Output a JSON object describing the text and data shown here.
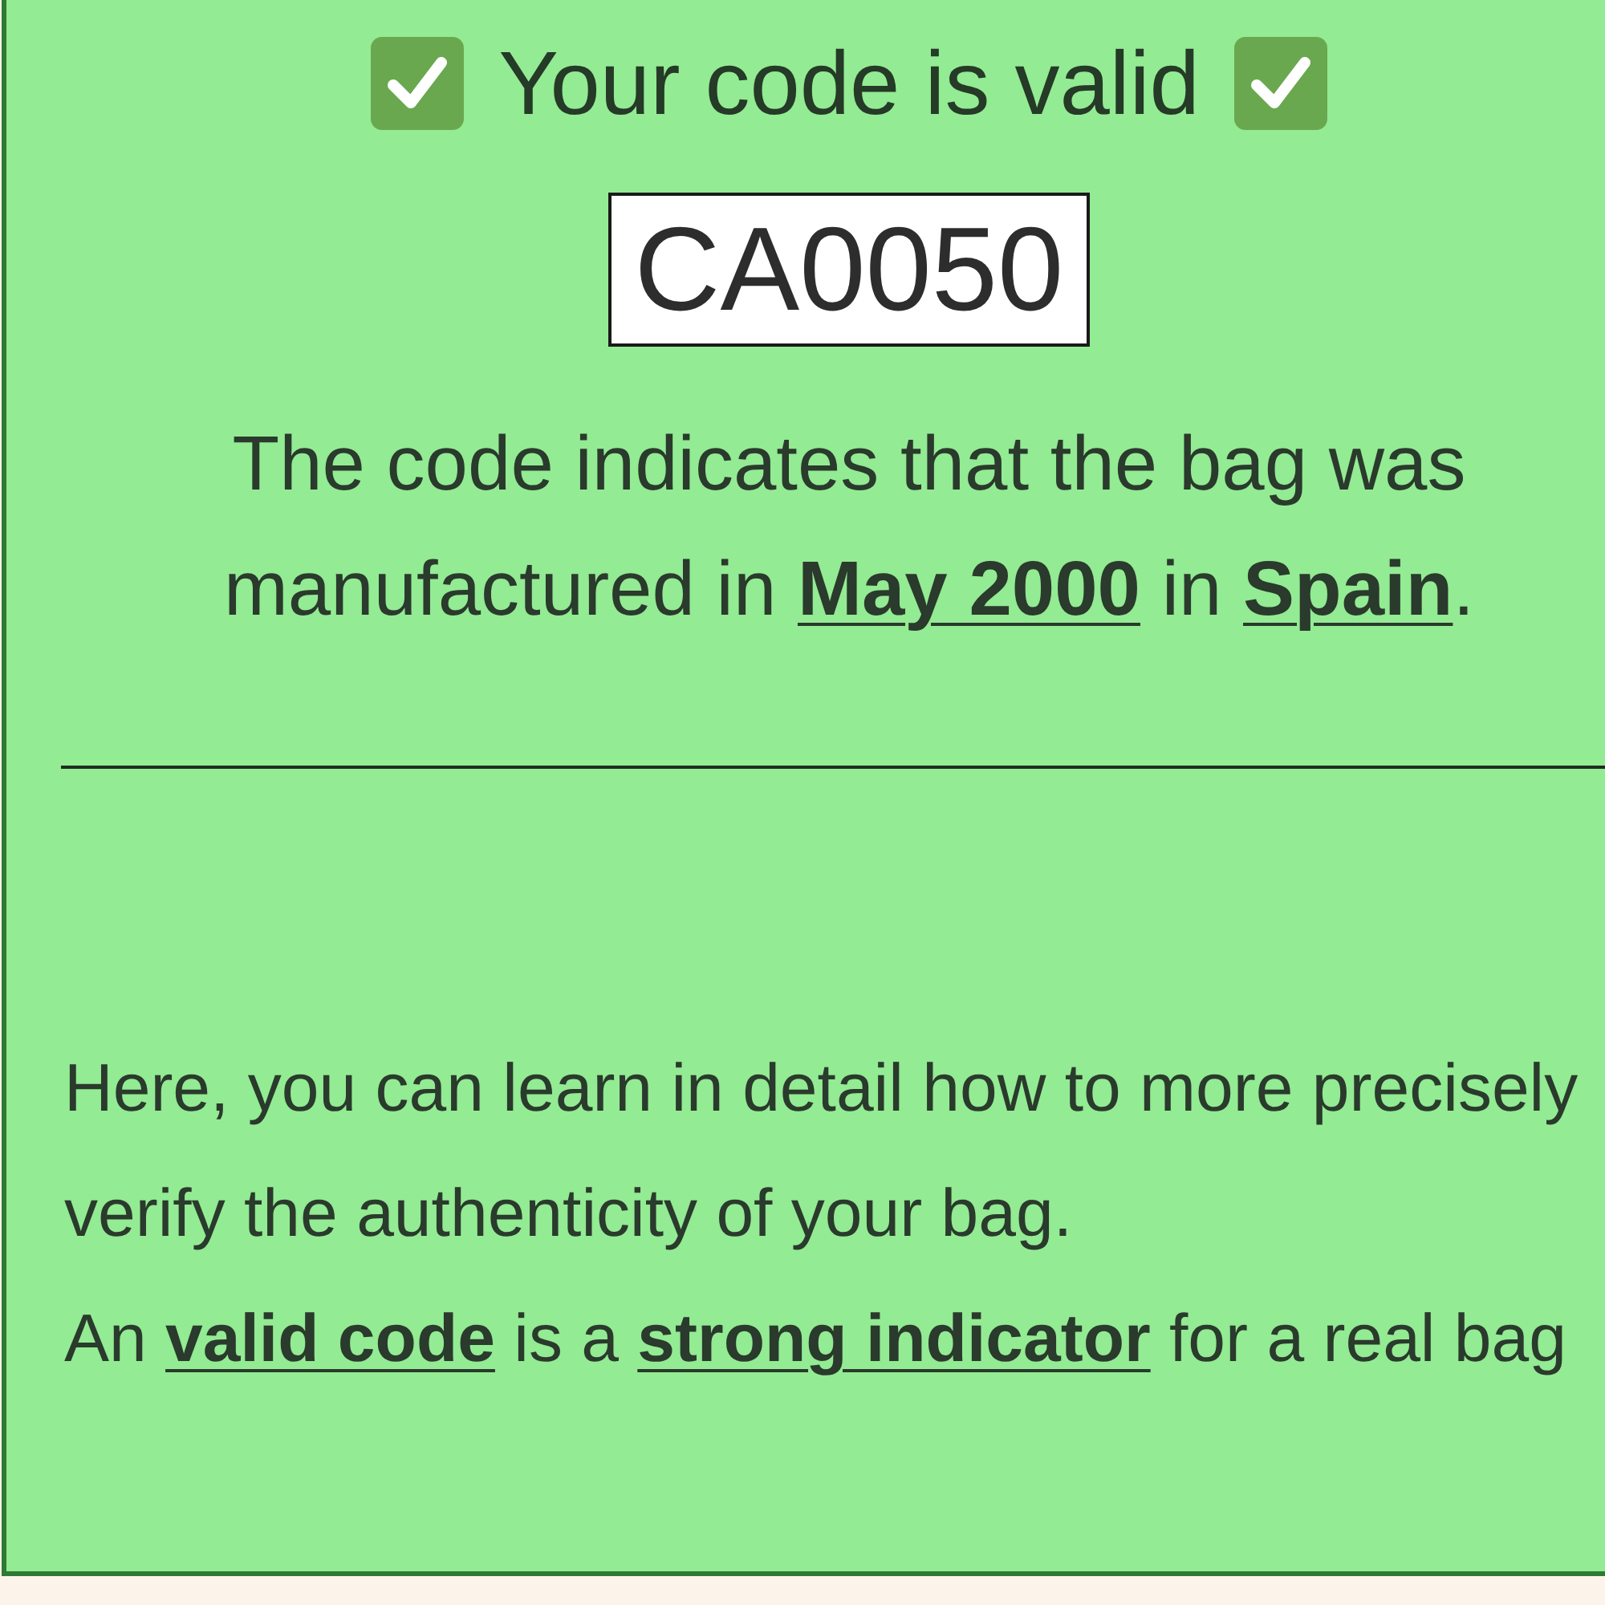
{
  "panel": {
    "title": "Your code is valid",
    "code": "CA0050",
    "result": "The code indicates that the bag was manufactured in **May 2000** in **Spain**.",
    "info": [
      "Here, you can learn in detail how to more precisely verify the authenticity of your bag.",
      "An **valid code** is a **strong indicator** for a real bag"
    ]
  }
}
